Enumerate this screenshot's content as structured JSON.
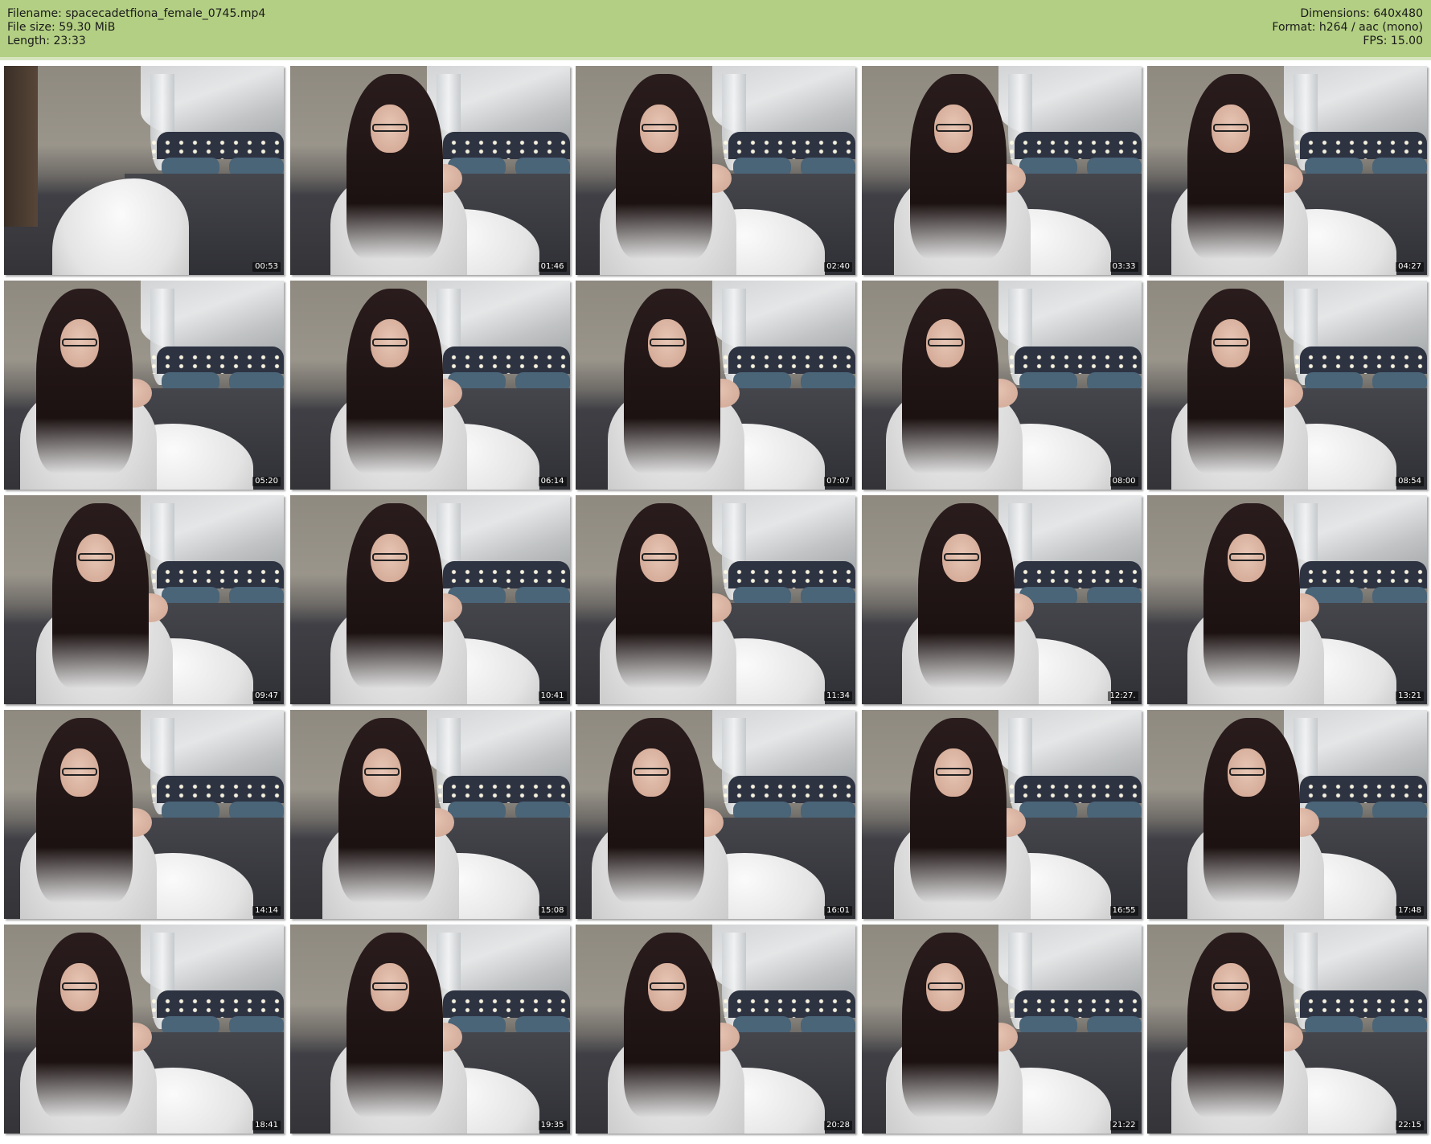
{
  "header": {
    "left": [
      {
        "label": "Filename:",
        "value": "spacecadetfiona_female_0745.mp4"
      },
      {
        "label": "File size:",
        "value": "59.30 MiB"
      },
      {
        "label": "Length:",
        "value": "23:33"
      }
    ],
    "right": [
      {
        "label": "Dimensions:",
        "value": "640x480"
      },
      {
        "label": "Format:",
        "value": "h264 / aac (mono)"
      },
      {
        "label": "FPS:",
        "value": "15.00"
      }
    ]
  },
  "thumbnails": [
    {
      "time": "00:53",
      "empty": true
    },
    {
      "time": "01:46"
    },
    {
      "time": "02:40"
    },
    {
      "time": "03:33"
    },
    {
      "time": "04:27"
    },
    {
      "time": "05:20"
    },
    {
      "time": "06:14"
    },
    {
      "time": "07:07"
    },
    {
      "time": "08:00"
    },
    {
      "time": "08:54"
    },
    {
      "time": "09:47"
    },
    {
      "time": "10:41"
    },
    {
      "time": "11:34"
    },
    {
      "time": "12:27."
    },
    {
      "time": "13:21"
    },
    {
      "time": "14:14"
    },
    {
      "time": "15:08"
    },
    {
      "time": "16:01"
    },
    {
      "time": "16:55"
    },
    {
      "time": "17:48"
    },
    {
      "time": "18:41"
    },
    {
      "time": "19:35"
    },
    {
      "time": "20:28"
    },
    {
      "time": "21:22"
    },
    {
      "time": "22:15"
    }
  ]
}
